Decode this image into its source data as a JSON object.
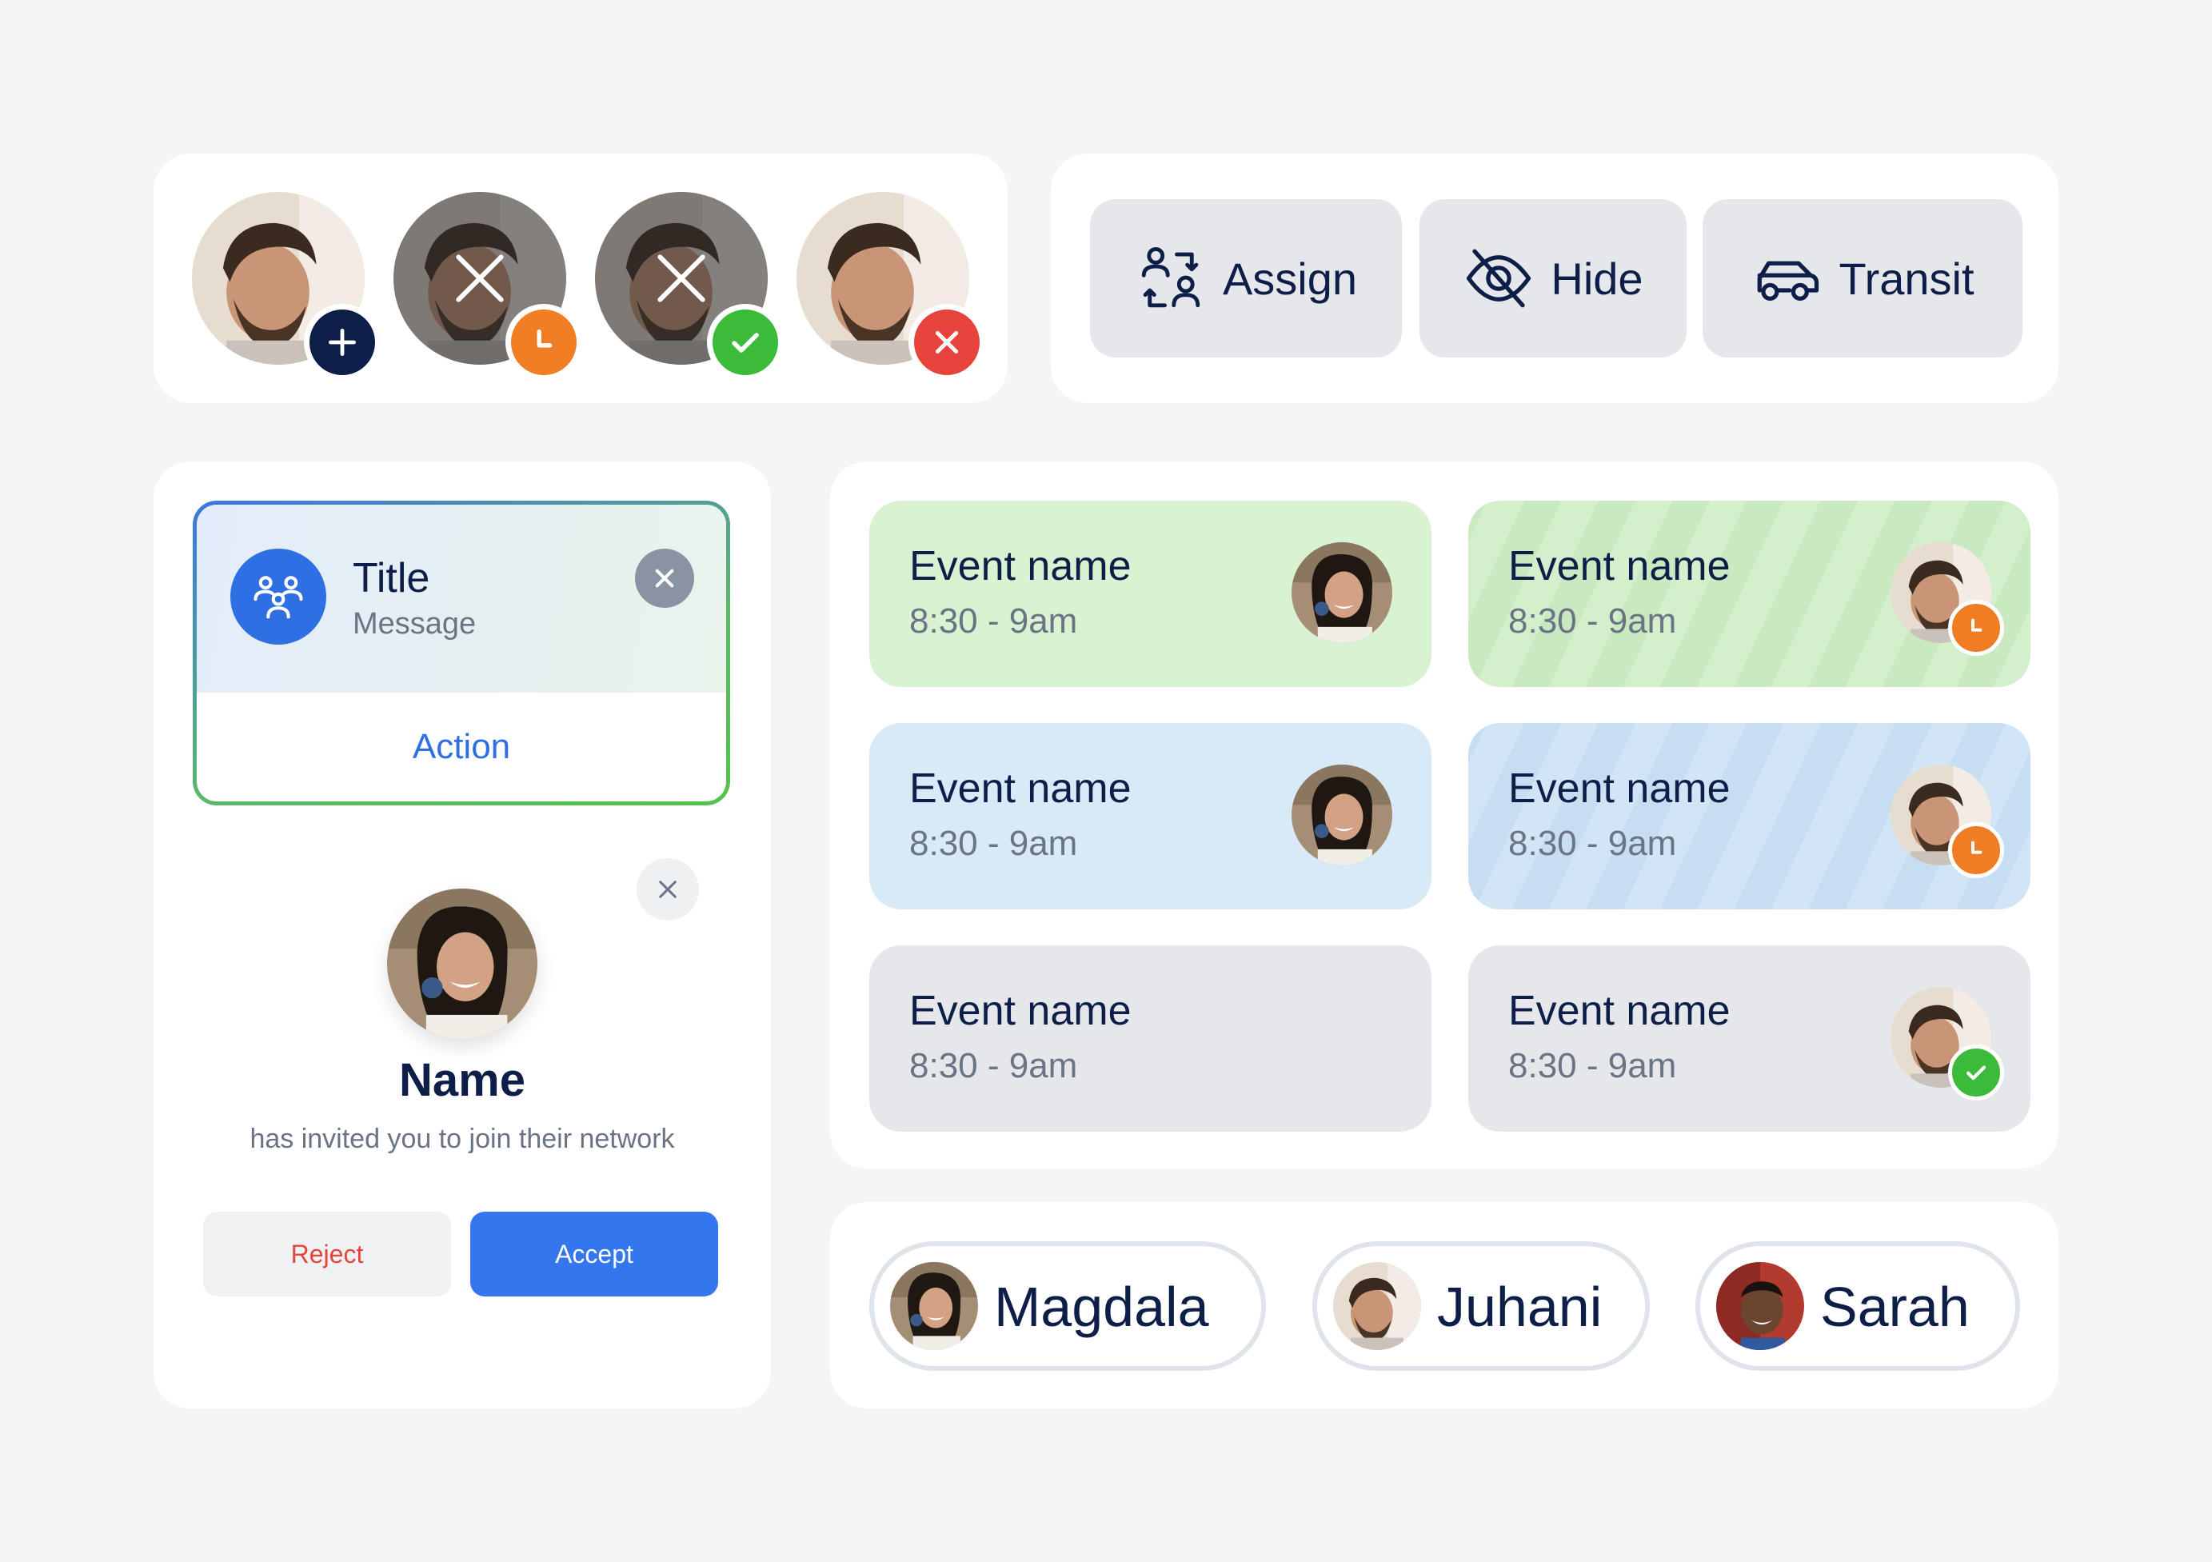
{
  "actions": {
    "assign_label": "Assign",
    "hide_label": "Hide",
    "transit_label": "Transit"
  },
  "avatar_badges": [
    {
      "badge": "plus-icon",
      "color": "#0d1e48",
      "state": "add"
    },
    {
      "badge": "clock-icon",
      "color": "#f07c24",
      "state": "pending"
    },
    {
      "badge": "check-icon",
      "color": "#3cba3a",
      "state": "accepted"
    },
    {
      "badge": "close-icon",
      "color": "#e5433b",
      "state": "declined"
    }
  ],
  "notification": {
    "title": "Title",
    "message": "Message",
    "action_label": "Action",
    "icon": "group-icon"
  },
  "invite": {
    "name": "Name",
    "subtitle": "has invited you to join their network",
    "reject_label": "Reject",
    "accept_label": "Accept"
  },
  "events": [
    {
      "name": "Event name",
      "time": "8:30 - 9am",
      "color": "green",
      "badge": ""
    },
    {
      "name": "Event name",
      "time": "8:30 - 9am",
      "color": "green",
      "badge": "clock-icon"
    },
    {
      "name": "Event name",
      "time": "8:30 - 9am",
      "color": "blue",
      "badge": ""
    },
    {
      "name": "Event name",
      "time": "8:30 - 9am",
      "color": "blue",
      "badge": "clock-icon"
    },
    {
      "name": "Event name",
      "time": "8:30 - 9am",
      "color": "grey",
      "badge": ""
    },
    {
      "name": "Event name",
      "time": "8:30 - 9am",
      "color": "grey",
      "badge": "check-icon"
    }
  ],
  "people": [
    {
      "name": "Magdala"
    },
    {
      "name": "Juhani"
    },
    {
      "name": "Sarah"
    }
  ],
  "colors": {
    "navy": "#0d1e48",
    "primary_blue": "#3376ee",
    "orange": "#f07c24",
    "green": "#3cba3a",
    "red": "#e5433b",
    "event_green": "#d9f2d2",
    "event_blue": "#d8eaf8",
    "event_grey": "#e5e7ea"
  }
}
